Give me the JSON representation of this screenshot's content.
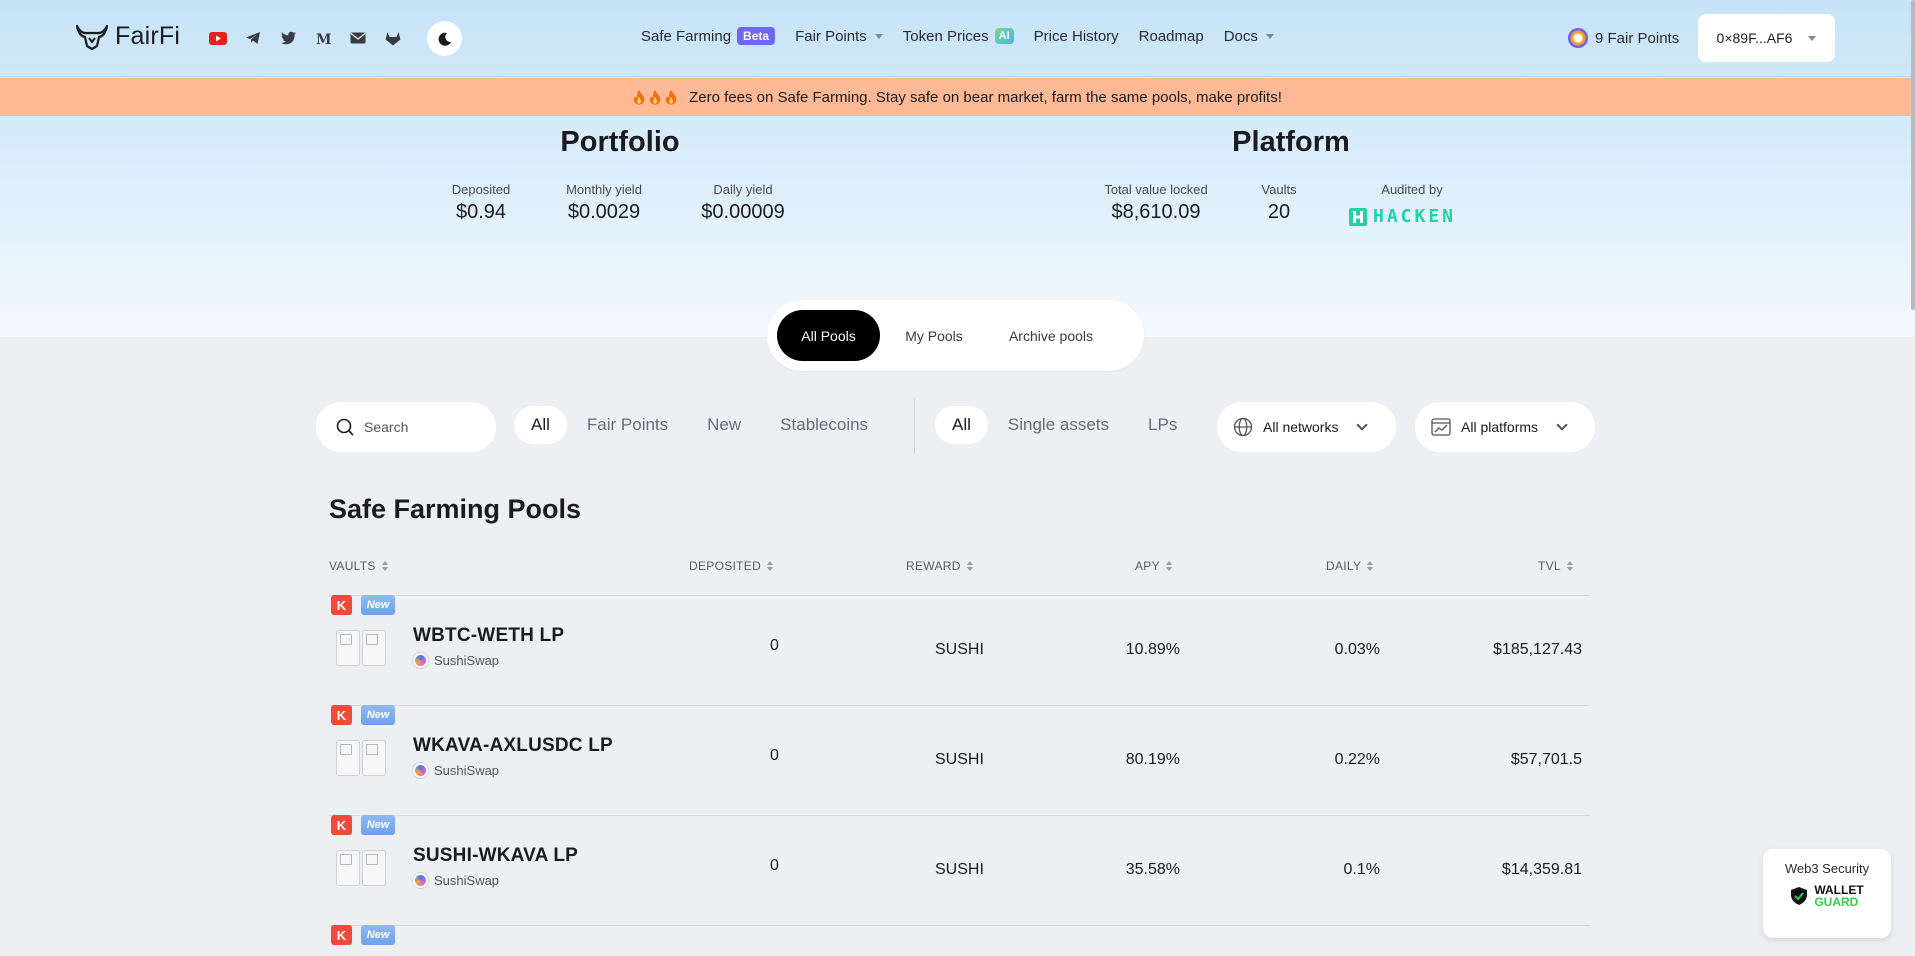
{
  "header": {
    "logo_text": "FairFi",
    "socials": [
      "youtube-icon",
      "telegram-icon",
      "twitter-icon",
      "medium-icon",
      "mail-icon",
      "gitlab-icon"
    ],
    "theme_icon": "moon-icon",
    "nav": {
      "safe_farming": "Safe Farming",
      "safe_farming_badge": "Beta",
      "fair_points": "Fair Points",
      "token_prices": "Token Prices",
      "token_prices_badge": "AI",
      "price_history": "Price History",
      "roadmap": "Roadmap",
      "docs": "Docs"
    },
    "fair_points_count": "9 Fair Points",
    "wallet_address": "0×89F...AF6"
  },
  "banner": {
    "text": "Zero fees on Safe Farming. Stay safe on bear market, farm the same pools, make profits!"
  },
  "portfolio": {
    "title": "Portfolio",
    "deposited_label": "Deposited",
    "deposited_value": "$0.94",
    "monthly_label": "Monthly yield",
    "monthly_value": "$0.0029",
    "daily_label": "Daily yield",
    "daily_value": "$0.00009"
  },
  "platform": {
    "title": "Platform",
    "tvl_label": "Total value locked",
    "tvl_value": "$8,610.09",
    "vaults_label": "Vaults",
    "vaults_value": "20",
    "audited_label": "Audited by",
    "auditor": "HACKEN"
  },
  "tabs": {
    "all_pools": "All Pools",
    "my_pools": "My Pools",
    "archive_pools": "Archive pools"
  },
  "filters": {
    "search_placeholder": "Search",
    "category_chips": [
      "All",
      "Fair Points",
      "New",
      "Stablecoins"
    ],
    "asset_chips": [
      "All",
      "Single assets",
      "LPs"
    ],
    "networks": "All networks",
    "platforms": "All platforms"
  },
  "table": {
    "title": "Safe Farming Pools",
    "headers": {
      "vaults": "VAULTS",
      "deposited": "DEPOSITED",
      "reward": "REWARD",
      "apy": "APY",
      "daily": "DAILY",
      "tvl": "TVL"
    },
    "tag_k": "K",
    "tag_new": "New",
    "rows": [
      {
        "pair": "WBTC-WETH LP",
        "platform": "SushiSwap",
        "deposited": "0",
        "reward": "SUSHI",
        "apy": "10.89%",
        "daily": "0.03%",
        "tvl": "$185,127.43"
      },
      {
        "pair": "WKAVA-AXLUSDC LP",
        "platform": "SushiSwap",
        "deposited": "0",
        "reward": "SUSHI",
        "apy": "80.19%",
        "daily": "0.22%",
        "tvl": "$57,701.5"
      },
      {
        "pair": "SUSHI-WKAVA LP",
        "platform": "SushiSwap",
        "deposited": "0",
        "reward": "SUSHI",
        "apy": "35.58%",
        "daily": "0.1%",
        "tvl": "$14,359.81"
      }
    ]
  },
  "wallet_guard": {
    "title": "Web3 Security",
    "line1": "WALLET",
    "line2": "GUARD"
  },
  "colors": {
    "banner": "#fdb895",
    "beta_badge": "#6f67f0",
    "tag_k": "#f04a3a",
    "hacken": "#1fd3a8",
    "guard_green": "#2fd24a"
  }
}
